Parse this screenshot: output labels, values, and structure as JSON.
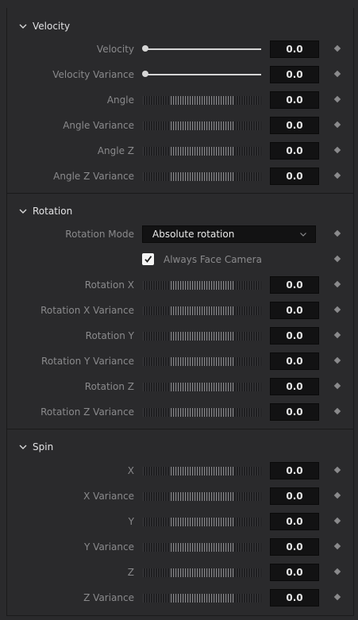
{
  "sections": {
    "velocity": {
      "title": "Velocity",
      "rows": [
        {
          "label": "Velocity",
          "value": "0.0"
        },
        {
          "label": "Velocity Variance",
          "value": "0.0"
        },
        {
          "label": "Angle",
          "value": "0.0"
        },
        {
          "label": "Angle Variance",
          "value": "0.0"
        },
        {
          "label": "Angle Z",
          "value": "0.0"
        },
        {
          "label": "Angle Z Variance",
          "value": "0.0"
        }
      ]
    },
    "rotation": {
      "title": "Rotation",
      "mode_label": "Rotation Mode",
      "mode_value": "Absolute rotation",
      "face_camera_label": "Always Face Camera",
      "face_camera_checked": true,
      "rows": [
        {
          "label": "Rotation X",
          "value": "0.0"
        },
        {
          "label": "Rotation X Variance",
          "value": "0.0"
        },
        {
          "label": "Rotation Y",
          "value": "0.0"
        },
        {
          "label": "Rotation Y Variance",
          "value": "0.0"
        },
        {
          "label": "Rotation Z",
          "value": "0.0"
        },
        {
          "label": "Rotation Z Variance",
          "value": "0.0"
        }
      ]
    },
    "spin": {
      "title": "Spin",
      "rows": [
        {
          "label": "X",
          "value": "0.0"
        },
        {
          "label": "X Variance",
          "value": "0.0"
        },
        {
          "label": "Y",
          "value": "0.0"
        },
        {
          "label": "Y Variance",
          "value": "0.0"
        },
        {
          "label": "Z",
          "value": "0.0"
        },
        {
          "label": "Z Variance",
          "value": "0.0"
        }
      ]
    }
  },
  "colors": {
    "panel_bg": "#2a2a2c",
    "field_bg": "#121213",
    "label_text": "#8a8a8c",
    "header_text": "#e2e2e4",
    "value_text": "#e6e6e6"
  },
  "icons": {
    "section_toggle": "chevron-down-icon",
    "keyframe": "keyframe-diamond-icon",
    "dropdown_arrow": "chevron-down-icon",
    "check": "checkmark-icon"
  }
}
